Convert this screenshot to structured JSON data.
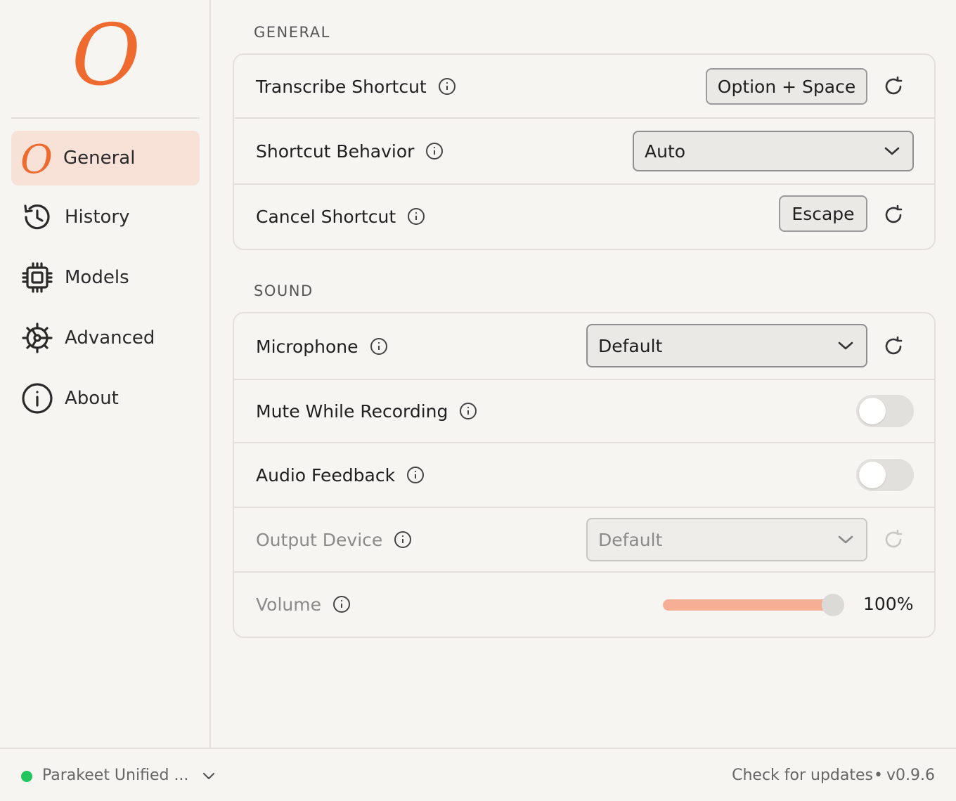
{
  "brand": {
    "logo_glyph": "O",
    "accent": "#ef6a2e"
  },
  "sidebar": {
    "items": [
      {
        "label": "General",
        "icon": "brand-o-icon",
        "active": true
      },
      {
        "label": "History",
        "icon": "history-icon"
      },
      {
        "label": "Models",
        "icon": "chip-icon"
      },
      {
        "label": "Advanced",
        "icon": "gear-icon"
      },
      {
        "label": "About",
        "icon": "info-icon"
      }
    ]
  },
  "general": {
    "title": "GENERAL",
    "transcribe_shortcut": {
      "label": "Transcribe Shortcut",
      "value": "Option + Space"
    },
    "shortcut_behavior": {
      "label": "Shortcut Behavior",
      "value": "Auto"
    },
    "cancel_shortcut": {
      "label": "Cancel Shortcut",
      "value": "Escape"
    }
  },
  "sound": {
    "title": "SOUND",
    "microphone": {
      "label": "Microphone",
      "value": "Default"
    },
    "mute_while_recording": {
      "label": "Mute While Recording",
      "enabled": false
    },
    "audio_feedback": {
      "label": "Audio Feedback",
      "enabled": false
    },
    "output_device": {
      "label": "Output Device",
      "value": "Default"
    },
    "volume": {
      "label": "Volume",
      "percent": 100,
      "display": "100%"
    }
  },
  "footer": {
    "model_name": "Parakeet Unified ...",
    "status_color": "#22c55e",
    "update_link": "Check for updates",
    "separator": "•",
    "version": "v0.9.6"
  }
}
